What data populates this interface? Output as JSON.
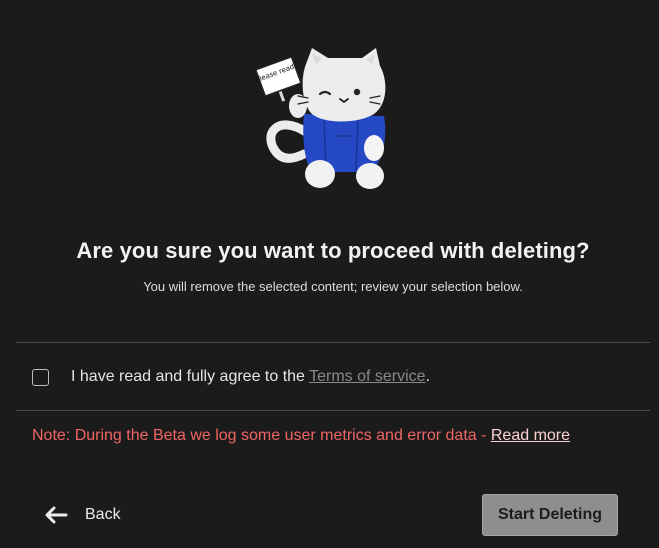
{
  "mascot": {
    "icon": "cat-mascot-with-sign",
    "sign_text": "Please read..",
    "colors": {
      "fur": "#ededed",
      "shirt": "#2548c4",
      "sign": "#ffffff"
    }
  },
  "dialog": {
    "title": "Are you sure you want to proceed with deleting?",
    "subtitle": "You will remove the selected content; review your selection below."
  },
  "agreement": {
    "checked": false,
    "text_before": "I have read and fully agree to the ",
    "link_text": "Terms of service",
    "text_after": "."
  },
  "note": {
    "text": "Note: During the Beta we log some user metrics and error data - ",
    "link_text": "Read more",
    "color": "#ef6464"
  },
  "actions": {
    "back_label": "Back",
    "back_icon": "arrow-left-icon",
    "start_label": "Start Deleting",
    "start_enabled": false
  }
}
